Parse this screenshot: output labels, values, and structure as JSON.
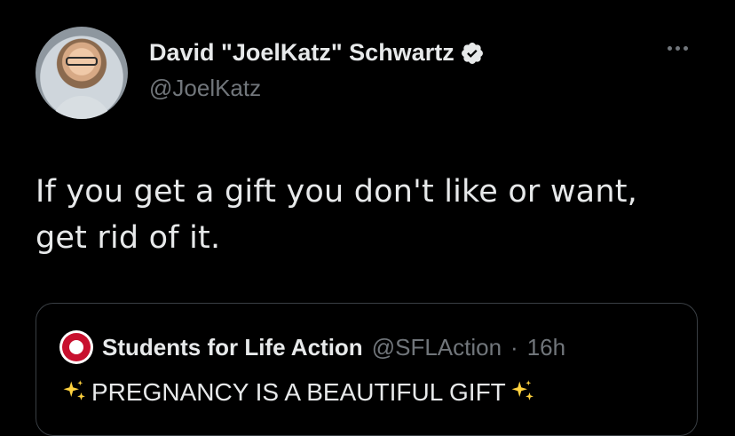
{
  "author": {
    "display_name": "David \"JoelKatz\" Schwartz",
    "handle": "@JoelKatz",
    "verified_icon": "verified-badge-icon",
    "avatar": "profile-photo"
  },
  "tweet": {
    "text_line1": "If you get a gift you don't like or want,",
    "text_line2": "get rid of it."
  },
  "quoted_tweet": {
    "display_name": "Students for Life Action",
    "handle": "@SFLAction",
    "separator": "·",
    "time": "16h",
    "text": "PREGNANCY IS A BEAUTIFUL GIFT",
    "emoji": "sparkles-icon"
  },
  "colors": {
    "background": "#000000",
    "text": "#e7e9ea",
    "secondary": "#71767b",
    "verified": "#e7e9ea",
    "sparkle": "#ffd23f"
  }
}
